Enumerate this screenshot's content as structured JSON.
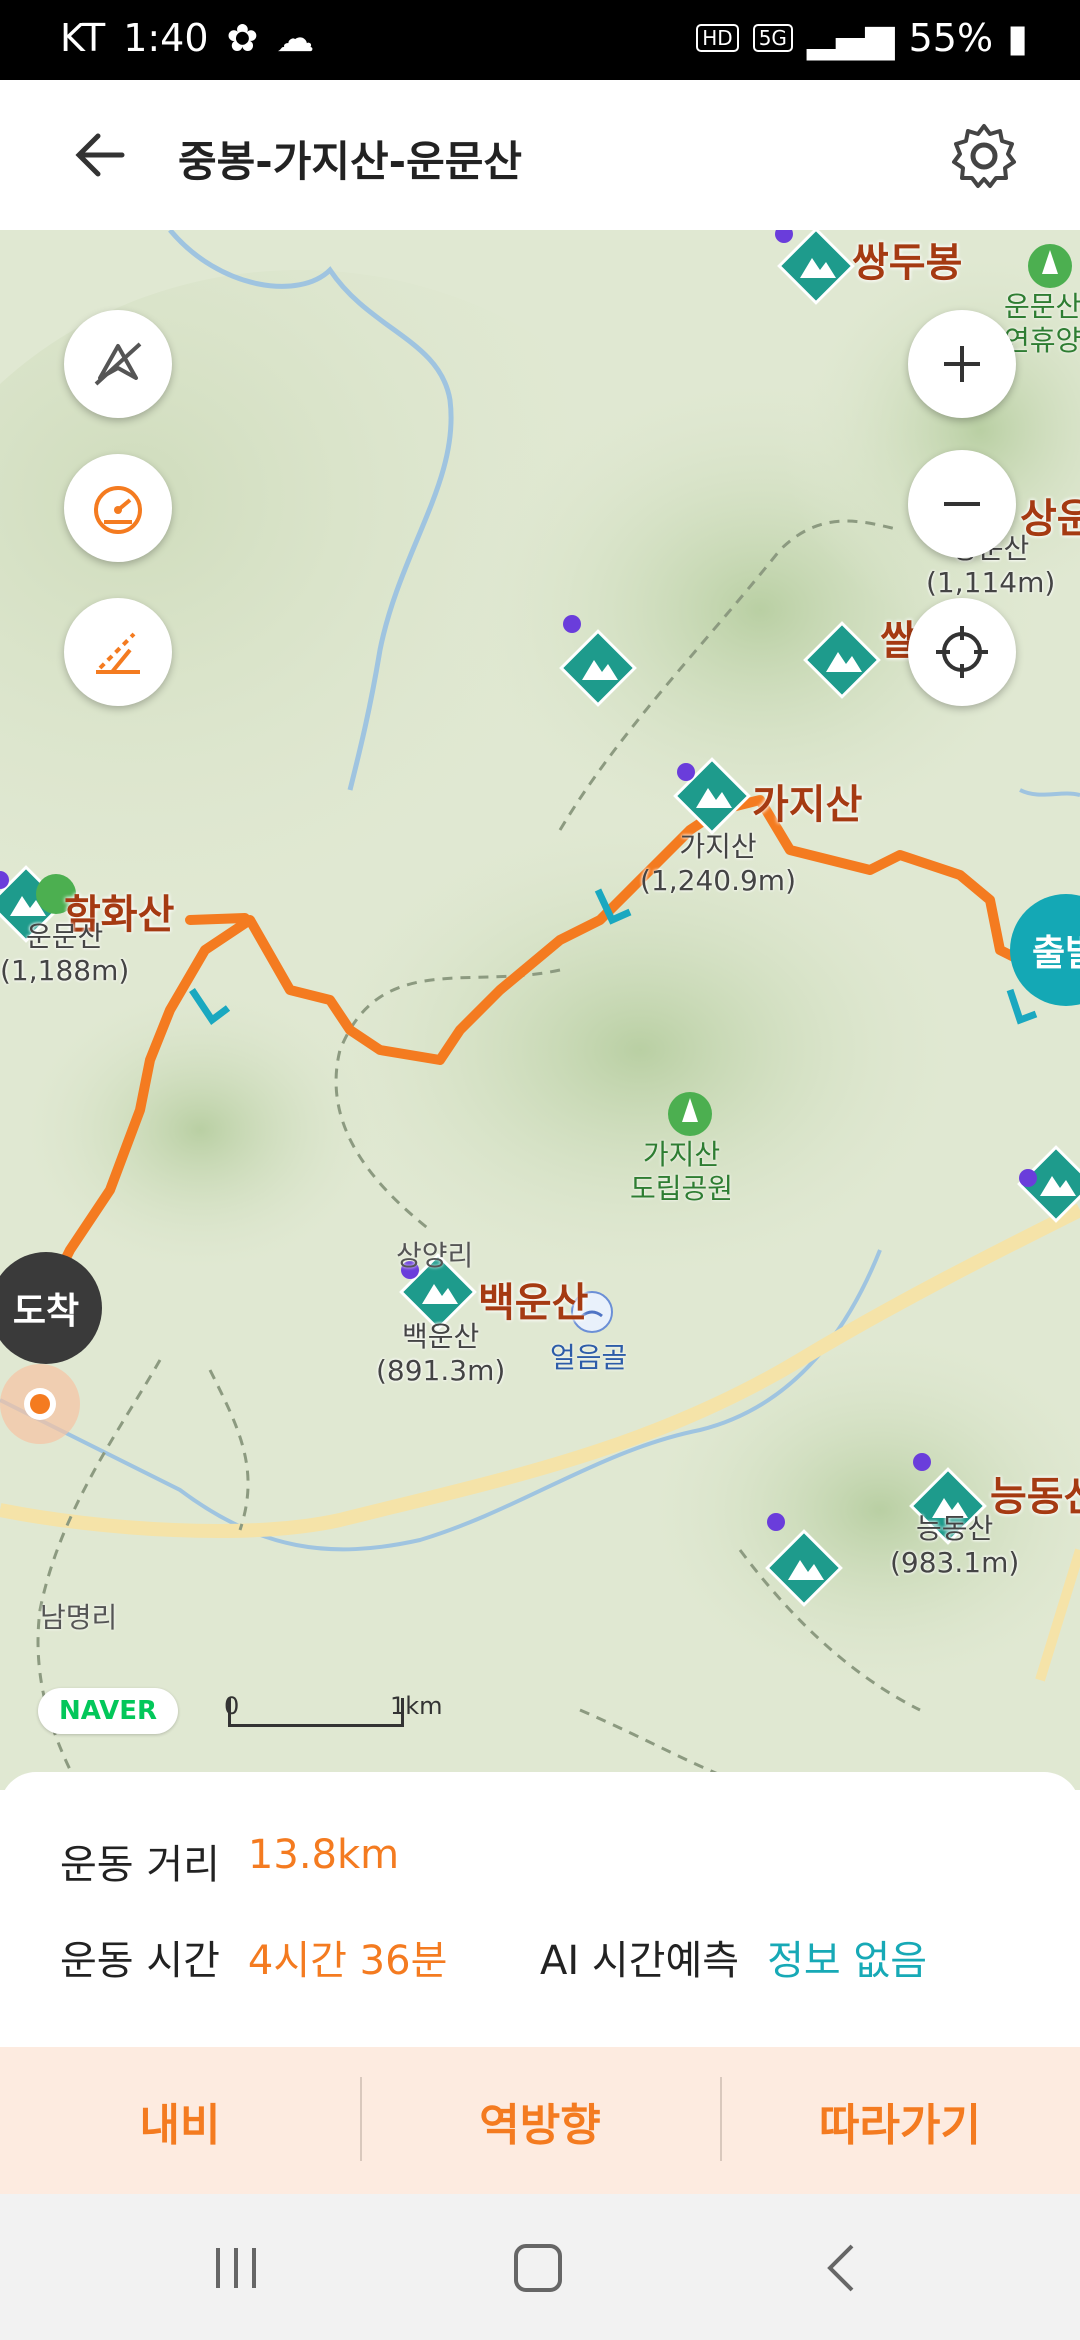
{
  "status_bar": {
    "carrier": "KT",
    "time": "1:40",
    "hd": "HD",
    "network": "5G",
    "battery": "55%"
  },
  "app_bar": {
    "title": "중봉-가지산-운문산"
  },
  "map": {
    "peaks": [
      {
        "name": "쌍두봉"
      },
      {
        "name": "가지산",
        "sub": "가지산",
        "elevation": "(1,240.9m)"
      },
      {
        "name": "함화산",
        "sub": "운문산",
        "elevation": "(1,188m)"
      },
      {
        "name": "백운산",
        "sub": "백운산",
        "elevation": "(891.3m)"
      },
      {
        "name": "능동산",
        "sub": "능동산",
        "elevation": "(983.1m)"
      },
      {
        "name": "상운",
        "sub": "상운산",
        "elevation": "(1,114m)"
      },
      {
        "name": "쌀"
      }
    ],
    "park_labels": {
      "gaji_park_1": "가지산",
      "gaji_park_2": "도립공원",
      "unmun_park_1": "운문산",
      "unmun_park_2": "연휴양"
    },
    "places": {
      "sangyangni": "상양리",
      "nammyeongni": "남명리",
      "eoreumgol": "얼음골"
    },
    "markers": {
      "arrive": "도착",
      "start": "출발"
    },
    "logo": "NAVER",
    "scale": {
      "zero": "0",
      "one": "1km"
    },
    "route_color": "#f47b20"
  },
  "stats": {
    "distance_label": "운동 거리",
    "distance_value": "13.8km",
    "time_label": "운동 시간",
    "time_value": "4시간 36분",
    "ai_label": "AI 시간예측",
    "ai_value": "정보 없음"
  },
  "actions": {
    "navi": "내비",
    "reverse": "역방향",
    "follow": "따라가기"
  }
}
